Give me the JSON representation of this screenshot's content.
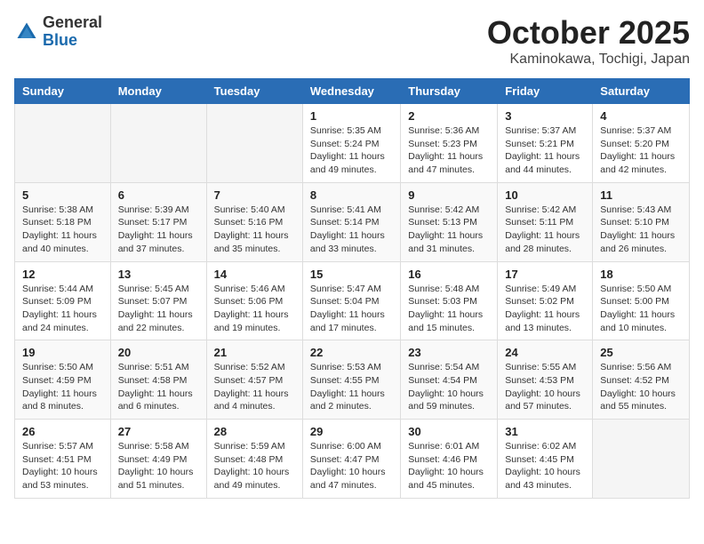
{
  "header": {
    "logo_general": "General",
    "logo_blue": "Blue",
    "month_title": "October 2025",
    "location": "Kaminokawa, Tochigi, Japan"
  },
  "days_of_week": [
    "Sunday",
    "Monday",
    "Tuesday",
    "Wednesday",
    "Thursday",
    "Friday",
    "Saturday"
  ],
  "weeks": [
    [
      {
        "day": "",
        "info": ""
      },
      {
        "day": "",
        "info": ""
      },
      {
        "day": "",
        "info": ""
      },
      {
        "day": "1",
        "info": "Sunrise: 5:35 AM\nSunset: 5:24 PM\nDaylight: 11 hours\nand 49 minutes."
      },
      {
        "day": "2",
        "info": "Sunrise: 5:36 AM\nSunset: 5:23 PM\nDaylight: 11 hours\nand 47 minutes."
      },
      {
        "day": "3",
        "info": "Sunrise: 5:37 AM\nSunset: 5:21 PM\nDaylight: 11 hours\nand 44 minutes."
      },
      {
        "day": "4",
        "info": "Sunrise: 5:37 AM\nSunset: 5:20 PM\nDaylight: 11 hours\nand 42 minutes."
      }
    ],
    [
      {
        "day": "5",
        "info": "Sunrise: 5:38 AM\nSunset: 5:18 PM\nDaylight: 11 hours\nand 40 minutes."
      },
      {
        "day": "6",
        "info": "Sunrise: 5:39 AM\nSunset: 5:17 PM\nDaylight: 11 hours\nand 37 minutes."
      },
      {
        "day": "7",
        "info": "Sunrise: 5:40 AM\nSunset: 5:16 PM\nDaylight: 11 hours\nand 35 minutes."
      },
      {
        "day": "8",
        "info": "Sunrise: 5:41 AM\nSunset: 5:14 PM\nDaylight: 11 hours\nand 33 minutes."
      },
      {
        "day": "9",
        "info": "Sunrise: 5:42 AM\nSunset: 5:13 PM\nDaylight: 11 hours\nand 31 minutes."
      },
      {
        "day": "10",
        "info": "Sunrise: 5:42 AM\nSunset: 5:11 PM\nDaylight: 11 hours\nand 28 minutes."
      },
      {
        "day": "11",
        "info": "Sunrise: 5:43 AM\nSunset: 5:10 PM\nDaylight: 11 hours\nand 26 minutes."
      }
    ],
    [
      {
        "day": "12",
        "info": "Sunrise: 5:44 AM\nSunset: 5:09 PM\nDaylight: 11 hours\nand 24 minutes."
      },
      {
        "day": "13",
        "info": "Sunrise: 5:45 AM\nSunset: 5:07 PM\nDaylight: 11 hours\nand 22 minutes."
      },
      {
        "day": "14",
        "info": "Sunrise: 5:46 AM\nSunset: 5:06 PM\nDaylight: 11 hours\nand 19 minutes."
      },
      {
        "day": "15",
        "info": "Sunrise: 5:47 AM\nSunset: 5:04 PM\nDaylight: 11 hours\nand 17 minutes."
      },
      {
        "day": "16",
        "info": "Sunrise: 5:48 AM\nSunset: 5:03 PM\nDaylight: 11 hours\nand 15 minutes."
      },
      {
        "day": "17",
        "info": "Sunrise: 5:49 AM\nSunset: 5:02 PM\nDaylight: 11 hours\nand 13 minutes."
      },
      {
        "day": "18",
        "info": "Sunrise: 5:50 AM\nSunset: 5:00 PM\nDaylight: 11 hours\nand 10 minutes."
      }
    ],
    [
      {
        "day": "19",
        "info": "Sunrise: 5:50 AM\nSunset: 4:59 PM\nDaylight: 11 hours\nand 8 minutes."
      },
      {
        "day": "20",
        "info": "Sunrise: 5:51 AM\nSunset: 4:58 PM\nDaylight: 11 hours\nand 6 minutes."
      },
      {
        "day": "21",
        "info": "Sunrise: 5:52 AM\nSunset: 4:57 PM\nDaylight: 11 hours\nand 4 minutes."
      },
      {
        "day": "22",
        "info": "Sunrise: 5:53 AM\nSunset: 4:55 PM\nDaylight: 11 hours\nand 2 minutes."
      },
      {
        "day": "23",
        "info": "Sunrise: 5:54 AM\nSunset: 4:54 PM\nDaylight: 10 hours\nand 59 minutes."
      },
      {
        "day": "24",
        "info": "Sunrise: 5:55 AM\nSunset: 4:53 PM\nDaylight: 10 hours\nand 57 minutes."
      },
      {
        "day": "25",
        "info": "Sunrise: 5:56 AM\nSunset: 4:52 PM\nDaylight: 10 hours\nand 55 minutes."
      }
    ],
    [
      {
        "day": "26",
        "info": "Sunrise: 5:57 AM\nSunset: 4:51 PM\nDaylight: 10 hours\nand 53 minutes."
      },
      {
        "day": "27",
        "info": "Sunrise: 5:58 AM\nSunset: 4:49 PM\nDaylight: 10 hours\nand 51 minutes."
      },
      {
        "day": "28",
        "info": "Sunrise: 5:59 AM\nSunset: 4:48 PM\nDaylight: 10 hours\nand 49 minutes."
      },
      {
        "day": "29",
        "info": "Sunrise: 6:00 AM\nSunset: 4:47 PM\nDaylight: 10 hours\nand 47 minutes."
      },
      {
        "day": "30",
        "info": "Sunrise: 6:01 AM\nSunset: 4:46 PM\nDaylight: 10 hours\nand 45 minutes."
      },
      {
        "day": "31",
        "info": "Sunrise: 6:02 AM\nSunset: 4:45 PM\nDaylight: 10 hours\nand 43 minutes."
      },
      {
        "day": "",
        "info": ""
      }
    ]
  ]
}
